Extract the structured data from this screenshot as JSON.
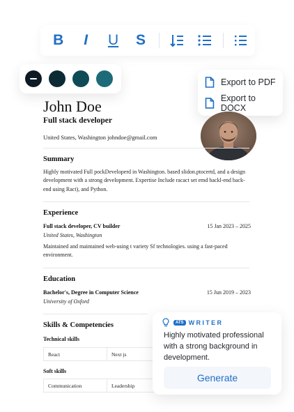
{
  "toolbar": {
    "bold": "B",
    "italic": "I",
    "underline": "U",
    "strike": "S"
  },
  "swatches": {
    "colors": [
      "#0e1a24",
      "#0c2b34",
      "#0f4a57",
      "#1d6a78"
    ],
    "selected_index": 0
  },
  "export_menu": {
    "pdf_label": "Export to PDF",
    "docx_label": "Export to DOCX"
  },
  "resume": {
    "name": "John Doe",
    "role": "Full stack developer",
    "contact": "United States, Washington johndoe@gmail.com",
    "summary": {
      "title": "Summary",
      "text": "Highly motivated Full pockDeveloperd in Washington. baseđ slidon.ptocertd, and a design development with a strong development. Expertise Include racact set emd backl-end back-end using Ract), and Python."
    },
    "experience": {
      "title": "Experience",
      "position": "Full stack developer, CV builder",
      "dates": "15 Jan 2023 – 2025",
      "location": "United States, Washington",
      "description": "Maintained and maintained web-using t variety Sf technologies. using a fast-paced environment."
    },
    "education": {
      "title": "Education",
      "degree": "Bachelor's, Degree in Computer Science",
      "dates": "15 Jun 2019 – 2023",
      "school": "University of Oxford"
    },
    "skills": {
      "title": "Skills & Competencies",
      "technical_label": "Technical skills",
      "technical": [
        "React",
        "Next js"
      ],
      "soft_label": "Soft skills",
      "soft": [
        "Communication",
        "Leadership"
      ]
    }
  },
  "writer": {
    "badge": "ATS",
    "title": "WRITER",
    "text": "Highly motivated professional with a strong background in development.",
    "button": "Generate"
  },
  "colors": {
    "accent": "#1f6fc7"
  },
  "icons": [
    "align-left-icon",
    "bullet-list-icon",
    "list-icon",
    "document-icon",
    "lightbulb-icon"
  ]
}
